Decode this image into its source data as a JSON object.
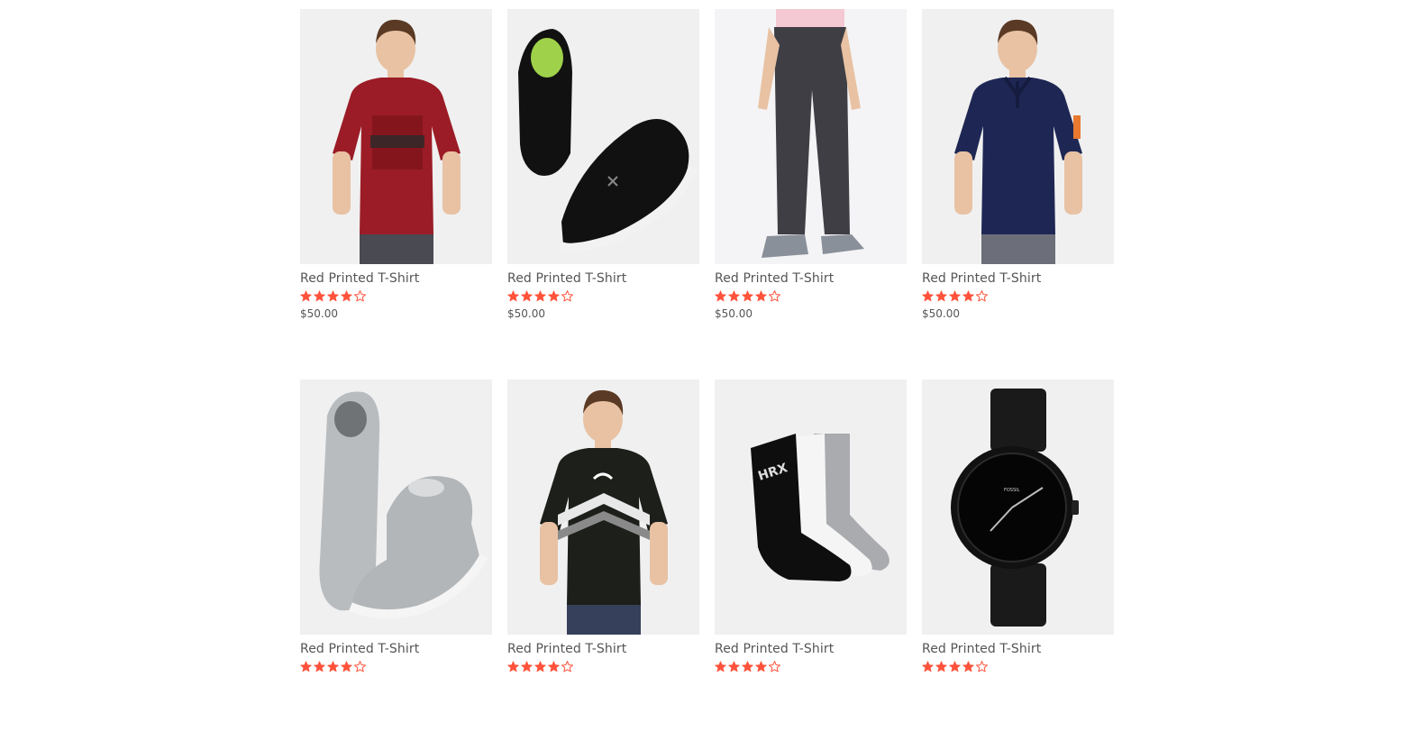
{
  "accent_color": "#ff523b",
  "products": [
    {
      "title": "Red Printed T-Shirt",
      "price": "$50.00",
      "rating": 4,
      "rating_max": 5,
      "image": "red-tshirt-model",
      "light": false
    },
    {
      "title": "Red Printed T-Shirt",
      "price": "$50.00",
      "rating": 4,
      "rating_max": 5,
      "image": "black-sneakers",
      "light": false
    },
    {
      "title": "Red Printed T-Shirt",
      "price": "$50.00",
      "rating": 4,
      "rating_max": 5,
      "image": "grey-trousers",
      "light": true
    },
    {
      "title": "Red Printed T-Shirt",
      "price": "$50.00",
      "rating": 4,
      "rating_max": 5,
      "image": "navy-polo-model",
      "light": false
    },
    {
      "title": "Red Printed T-Shirt",
      "price": "",
      "rating": 4,
      "rating_max": 5,
      "image": "grey-high-top-sneakers",
      "light": false
    },
    {
      "title": "Red Printed T-Shirt",
      "price": "",
      "rating": 4,
      "rating_max": 5,
      "image": "black-puma-tshirt-model",
      "light": false
    },
    {
      "title": "Red Printed T-Shirt",
      "price": "",
      "rating": 4,
      "rating_max": 5,
      "image": "hrx-socks",
      "light": false
    },
    {
      "title": "Red Printed T-Shirt",
      "price": "",
      "rating": 4,
      "rating_max": 5,
      "image": "black-fossil-watch",
      "light": false
    }
  ]
}
